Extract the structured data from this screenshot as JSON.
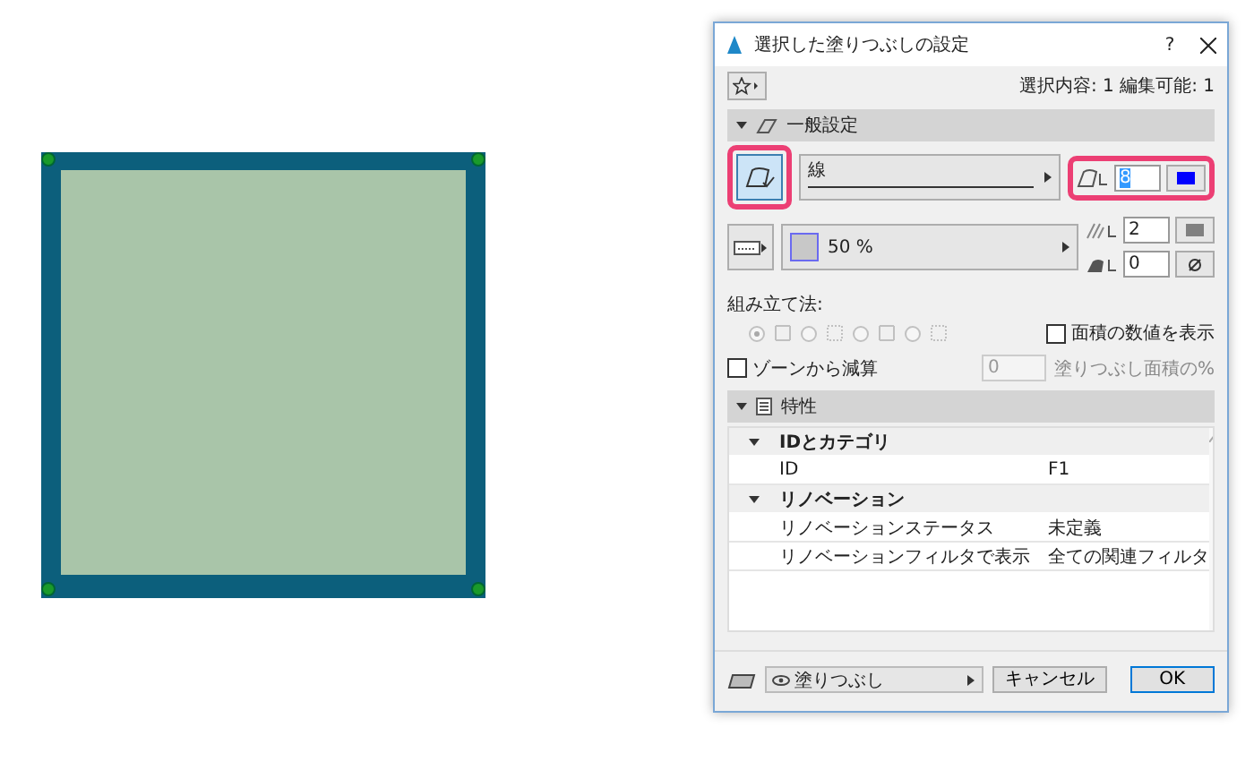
{
  "dialog": {
    "title": "選択した塗りつぶしの設定",
    "help": "?",
    "selection_info": "選択内容: 1 編集可能: 1",
    "general": {
      "title": "一般設定",
      "expanded": true,
      "line_type": "線",
      "fill_percent": "50 %",
      "pen": {
        "value": "8",
        "color": "#0000ff",
        "highlighted": true
      },
      "icon_button_highlighted": true,
      "pen2": {
        "value": "2",
        "color": "#808080"
      },
      "pen3": {
        "value": "0"
      },
      "construction_label": "組み立て法:",
      "construction": [
        {
          "selected": true
        },
        {
          "selected": false
        },
        {
          "selected": false
        },
        {
          "selected": false
        }
      ],
      "construction_disabled": true,
      "show_area": {
        "label": "面積の数値を表示",
        "checked": false
      },
      "subtract": {
        "label": "ゾーンから減算",
        "checked": false
      },
      "percent_field": {
        "value": "0",
        "disabled": true
      },
      "percent_label": "塗りつぶし面積の%"
    },
    "properties": {
      "title": "特性",
      "expanded": true,
      "groups": [
        {
          "name": "IDとカテゴリ",
          "expanded": true,
          "children": [
            {
              "name": "ID",
              "value": "F1"
            }
          ]
        },
        {
          "name": "リノベーション",
          "expanded": true,
          "children": [
            {
              "name": "リノベーションステータス",
              "value": "未定義"
            },
            {
              "name": "リノベーションフィルタで表示",
              "value": "全ての関連フィルタ"
            }
          ]
        }
      ]
    },
    "layer": "塗りつぶし",
    "buttons": [
      {
        "label": "キャンセル",
        "default": false
      },
      {
        "label": "OK",
        "default": true
      }
    ]
  }
}
